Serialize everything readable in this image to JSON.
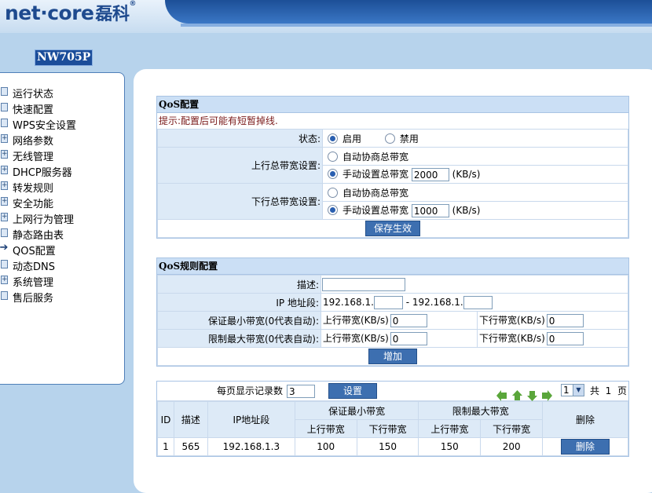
{
  "header": {
    "brand": "net·core",
    "brand_cn": "磊科",
    "reg": "®",
    "model": "NW705P"
  },
  "sidebar": {
    "items": [
      {
        "label": "运行状态",
        "icon": "page-icon"
      },
      {
        "label": "快速配置",
        "icon": "page-icon"
      },
      {
        "label": "WPS安全设置",
        "icon": "page-icon"
      },
      {
        "label": "网络参数",
        "icon": "expand-icon"
      },
      {
        "label": "无线管理",
        "icon": "expand-icon"
      },
      {
        "label": "DHCP服务器",
        "icon": "expand-icon"
      },
      {
        "label": "转发规则",
        "icon": "expand-icon"
      },
      {
        "label": "安全功能",
        "icon": "expand-icon"
      },
      {
        "label": "上网行为管理",
        "icon": "expand-icon"
      },
      {
        "label": "静态路由表",
        "icon": "page-icon"
      },
      {
        "label": "QOS配置",
        "icon": "arrow-right-icon"
      },
      {
        "label": "动态DNS",
        "icon": "page-icon"
      },
      {
        "label": "系统管理",
        "icon": "expand-icon"
      },
      {
        "label": "售后服务",
        "icon": "page-icon"
      }
    ]
  },
  "qos": {
    "title": "QoS配置",
    "tip": "提示:配置后可能有短暂掉线.",
    "status_label": "状态:",
    "enable": "启用",
    "disable": "禁用",
    "up_label": "上行总带宽设置:",
    "down_label": "下行总带宽设置:",
    "auto": "自动协商总带宽",
    "manual": "手动设置总带宽",
    "up_value": "2000",
    "down_value": "1000",
    "unit": "(KB/s)",
    "save": "保存生效"
  },
  "rule": {
    "title": "QoS规则配置",
    "desc_label": "描述:",
    "desc_value": "",
    "ip_label": "IP 地址段:",
    "ip_prefix": "192.168.1.",
    "ip_sep": "- 192.168.1.",
    "ip_start": "",
    "ip_end": "",
    "min_label": "保证最小带宽(0代表自动):",
    "max_label": "限制最大带宽(0代表自动):",
    "up_kb": "上行带宽(KB/s)",
    "down_kb": "下行带宽(KB/s)",
    "min_up": "0",
    "min_down": "0",
    "max_up": "0",
    "max_down": "0",
    "add": "增加"
  },
  "list": {
    "per_page_label": "每页显示记录数",
    "per_page": "3",
    "set": "设置",
    "page": "1",
    "total_prefix": "共",
    "total_pages": "1",
    "total_suffix": "页",
    "headers": {
      "id": "ID",
      "desc": "描述",
      "ip": "IP地址段",
      "min": "保证最小带宽",
      "max": "限制最大带宽",
      "up": "上行带宽",
      "down": "下行带宽",
      "del": "删除"
    },
    "rows": [
      {
        "id": "1",
        "desc": "565",
        "ip": "192.168.1.3",
        "min_up": "100",
        "min_down": "150",
        "max_up": "150",
        "max_down": "200",
        "del": "删除"
      }
    ]
  }
}
